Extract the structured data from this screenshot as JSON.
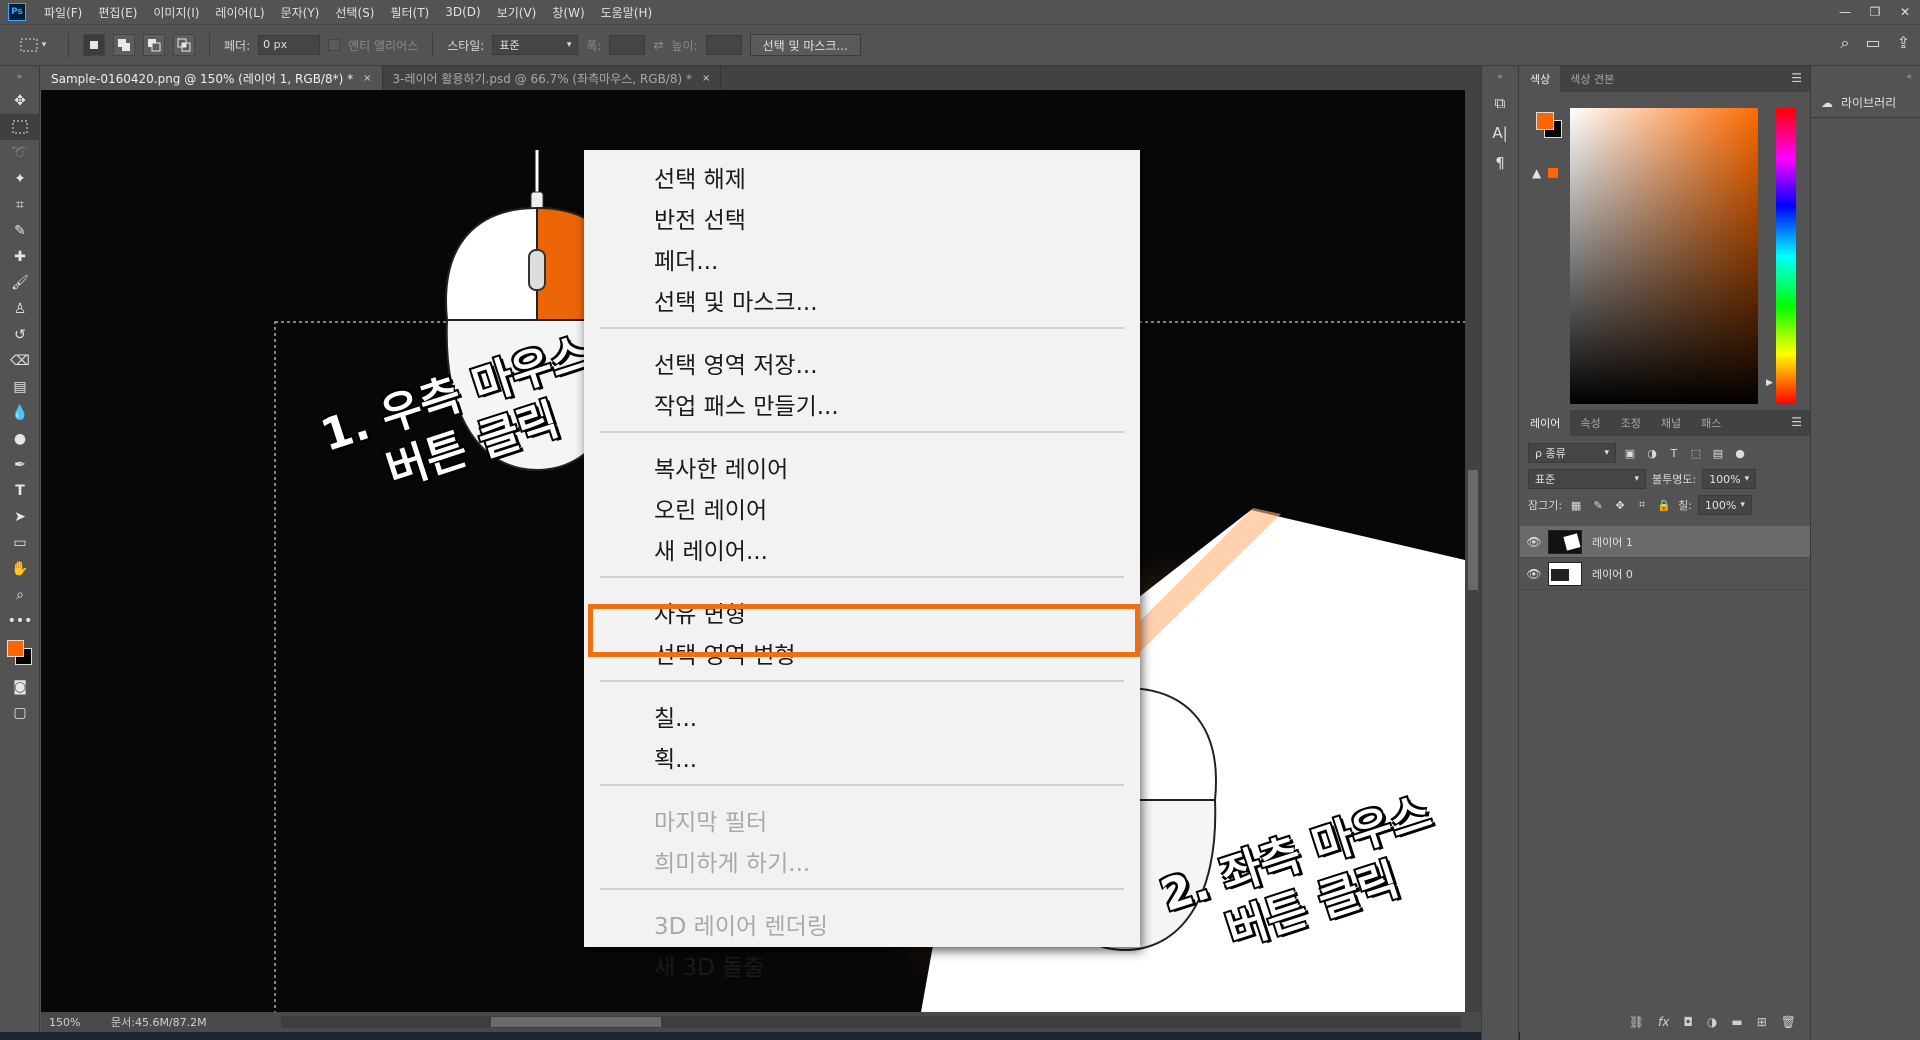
{
  "menubar": {
    "logo": "Ps",
    "items": [
      "파일(F)",
      "편집(E)",
      "이미지(I)",
      "레이어(L)",
      "문자(Y)",
      "선택(S)",
      "필터(T)",
      "3D(D)",
      "보기(V)",
      "창(W)",
      "도움말(H)"
    ],
    "window_controls": [
      "—",
      "❐",
      "✕"
    ]
  },
  "options": {
    "feather_label": "페더:",
    "feather_value": "0 px",
    "antialias_label": "앤티 앨리어스",
    "style_label": "스타일:",
    "style_value": "표준",
    "width_label": "폭:",
    "height_label": "높이:",
    "select_mask_button": "선택 및 마스크..."
  },
  "tabs": [
    {
      "label": "Sample-0160420.png @ 150% (레이어 1, RGB/8*) *",
      "close": "×"
    },
    {
      "label": "3-레이어 활용하기.psd @ 66.7% (좌측마우스, RGB/8) *",
      "close": "×"
    }
  ],
  "status": {
    "zoom": "150%",
    "doc": "문서:45.6M/87.2M",
    "arrow": "›"
  },
  "annotations": {
    "step1_line1": "1. 우측 마우스",
    "step1_line2": "버튼 클릭",
    "step2_line1": "2. 좌측 마우스",
    "step2_line2": "버튼 클릭"
  },
  "context_menu": {
    "groups": [
      [
        {
          "label": "선택 해제",
          "enabled": true
        },
        {
          "label": "반전 선택",
          "enabled": true
        },
        {
          "label": "페더...",
          "enabled": true
        },
        {
          "label": "선택 및 마스크...",
          "enabled": true
        }
      ],
      [
        {
          "label": "선택 영역 저장...",
          "enabled": true
        },
        {
          "label": "작업 패스 만들기...",
          "enabled": true
        }
      ],
      [
        {
          "label": "복사한 레이어",
          "enabled": true
        },
        {
          "label": "오린 레이어",
          "enabled": true
        },
        {
          "label": "새 레이어...",
          "enabled": true
        }
      ],
      [
        {
          "label": "자유 변형",
          "enabled": true
        },
        {
          "label": "선택 영역 변형",
          "enabled": true,
          "highlighted": true
        }
      ],
      [
        {
          "label": "칠...",
          "enabled": true
        },
        {
          "label": "획...",
          "enabled": true
        }
      ],
      [
        {
          "label": "마지막 필터",
          "enabled": false
        },
        {
          "label": "희미하게 하기...",
          "enabled": false
        }
      ],
      [
        {
          "label": "3D 레이어 렌더링",
          "enabled": false
        },
        {
          "label": "새 3D 돌출",
          "enabled": true
        }
      ]
    ]
  },
  "color_panel": {
    "tabs": [
      "색상",
      "색상 견본"
    ],
    "foreground": "#ff6600",
    "background": "#000000"
  },
  "layers_panel": {
    "tabs": [
      "레이어",
      "속성",
      "조정",
      "채널",
      "패스"
    ],
    "filter_label": "ρ 종류",
    "blend_mode": "표준",
    "opacity_label": "불투명도:",
    "opacity_value": "100%",
    "lock_label": "잠그기:",
    "fill_label": "칠:",
    "fill_value": "100%",
    "layers": [
      {
        "name": "레이어 1",
        "selected": true
      },
      {
        "name": "레이어 0",
        "selected": false
      }
    ]
  },
  "library": {
    "label": "라이브러리"
  },
  "colors": {
    "accent": "#f07010",
    "ui_bg": "#535353",
    "menu_bg": "#f2f2f2"
  }
}
